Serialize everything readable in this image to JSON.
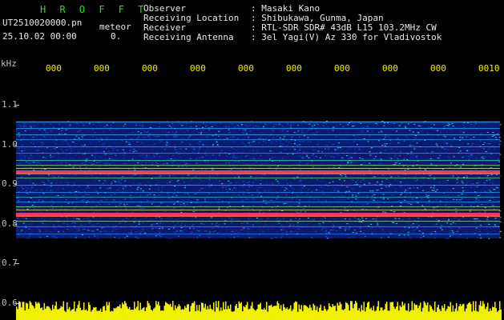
{
  "header": {
    "app_title": "H R O F F T",
    "filename": "UT2510020000.pn",
    "mode": "meteor",
    "datetime": "25.10.02 00:00",
    "value": "0.",
    "labels": {
      "observer": "Observer",
      "location": "Receiving Location",
      "receiver": "Receiver",
      "antenna": "Receiving Antenna"
    },
    "values": {
      "observer": ": Masaki Kano",
      "location": ": Shibukawa, Gunma, Japan",
      "receiver": ": RTL-SDR SDR# 43dB L15 103.2MHz CW",
      "antenna": ": 3el Yagi(V) Az 330 for Vladivostok"
    }
  },
  "axis": {
    "unit": "kHz",
    "y_ticks": [
      "1.1",
      "1.0",
      "0.9",
      "0.8",
      "0.7",
      "0.6"
    ],
    "x_ticks": [
      "000",
      "000",
      "000",
      "000",
      "000",
      "000",
      "000",
      "000",
      "000",
      "0010"
    ]
  },
  "colors": {
    "background": "#000000",
    "title": "#22e022",
    "time_ticks": "#f0f000",
    "freq_ticks": "#bdbdbd",
    "power_trace": "#f0f000"
  }
}
